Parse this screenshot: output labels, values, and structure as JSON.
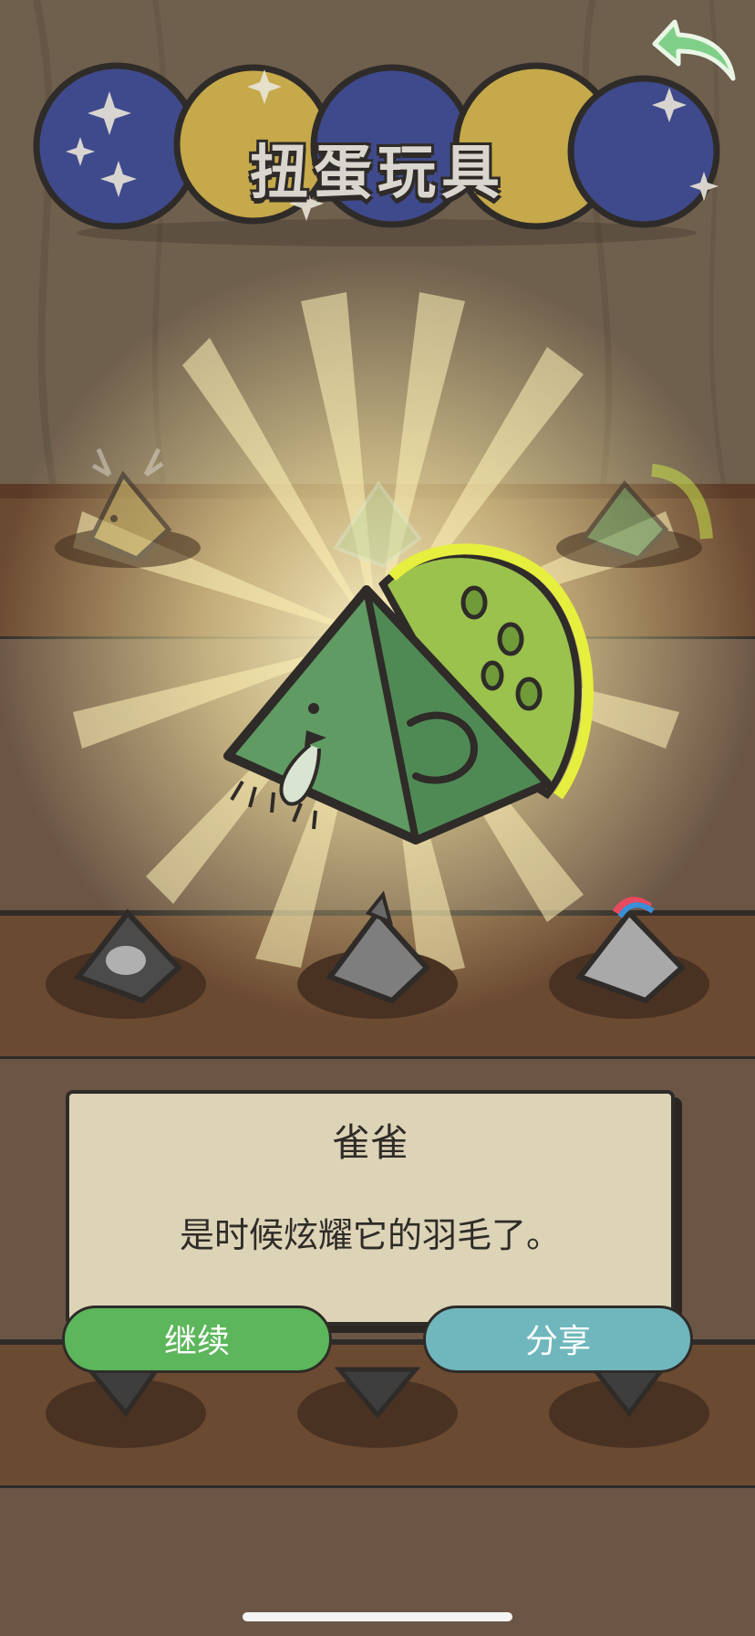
{
  "header": {
    "title": "扭蛋玩具"
  },
  "back_button": {
    "icon": "back-arrow-icon"
  },
  "featured_toy": {
    "icon": "peacock-pyramid-icon",
    "shine": "glow-rays"
  },
  "shelf_items": [
    {
      "icon": "deer-pyramid-icon",
      "state": "dimmed"
    },
    {
      "icon": "bird-pyramid-icon",
      "state": "dimmed"
    },
    {
      "icon": "peacock-pyramid-icon",
      "state": "dimmed"
    },
    {
      "icon": "gorilla-pyramid-icon",
      "state": "collected"
    },
    {
      "icon": "shark-pyramid-icon",
      "state": "collected"
    },
    {
      "icon": "unicorn-pyramid-icon",
      "state": "collected"
    }
  ],
  "dialog": {
    "title": "雀雀",
    "text": "是时候炫耀它的羽毛了。"
  },
  "buttons": {
    "continue": "继续",
    "share": "分享"
  },
  "colors": {
    "background": "#6e5b48",
    "shelf": "#6b4a32",
    "dialog": "#ddd4b7",
    "continue": "#5cb65b",
    "share": "#6fb7bd",
    "toy_green": "#5f9b62"
  }
}
